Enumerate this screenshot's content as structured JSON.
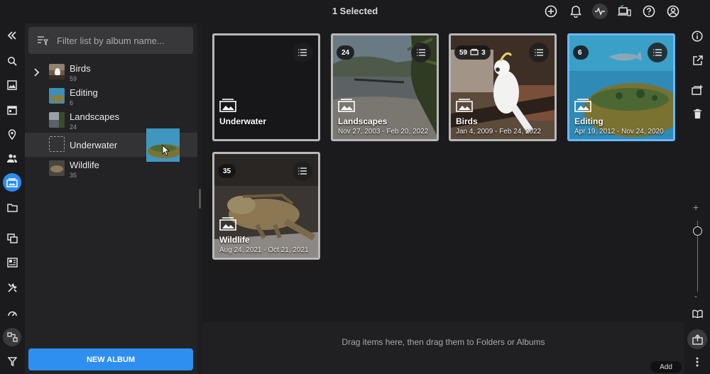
{
  "topbar": {
    "title": "1 Selected",
    "icons": [
      "add-circle-icon",
      "bell-icon",
      "activity-icon",
      "devices-icon",
      "help-icon",
      "account-icon"
    ]
  },
  "leftrail": {
    "icons": [
      "collapse-icon",
      "search-icon",
      "photo-icon",
      "calendar-icon",
      "location-icon",
      "people-icon",
      "albums-icon",
      "folder-icon",
      "compare-icon",
      "layout-icon",
      "tools-icon",
      "dashboard-icon",
      "workflow-icon",
      "filter-icon"
    ],
    "active": "albums-icon"
  },
  "panel": {
    "search_placeholder": "Filter list by album name...",
    "albums": [
      {
        "name": "Birds",
        "count": "59",
        "expandable": true
      },
      {
        "name": "Editing",
        "count": "6",
        "expandable": false
      },
      {
        "name": "Landscapes",
        "count": "24",
        "expandable": false
      },
      {
        "name": "Underwater",
        "count": "",
        "expandable": false,
        "selected": true
      },
      {
        "name": "Wildlife",
        "count": "35",
        "expandable": false
      }
    ],
    "new_album_label": "NEW ALBUM"
  },
  "grid": {
    "cards": [
      {
        "title": "Underwater",
        "date": "",
        "badge": "",
        "sub_badge": ""
      },
      {
        "title": "Landscapes",
        "date": "Nov 27, 2003 - Feb 20, 2022",
        "badge": "24",
        "sub_badge": ""
      },
      {
        "title": "Birds",
        "date": "Jan 4, 2009 - Feb 24, 2022",
        "badge": "59",
        "sub_badge": "3"
      },
      {
        "title": "Editing",
        "date": "Apr 19, 2012 - Nov 24, 2020",
        "badge": "6",
        "sub_badge": ""
      },
      {
        "title": "Wildlife",
        "date": "Aug 24, 2021 - Oct 21, 2021",
        "badge": "35",
        "sub_badge": ""
      }
    ]
  },
  "tray": {
    "message": "Drag items here, then drag them to Folders or Albums",
    "add_label": "Add"
  },
  "rightrail": {
    "icons": [
      "info-icon",
      "external-link-icon",
      "add-to-album-icon",
      "trash-icon",
      "zoom-in-icon",
      "zoom-out-icon",
      "book-icon",
      "export-icon",
      "more-icon"
    ]
  },
  "colors": {
    "accent": "#2f8ff0",
    "selected_border": "#69b7ff",
    "background": "#1b1b1d"
  }
}
